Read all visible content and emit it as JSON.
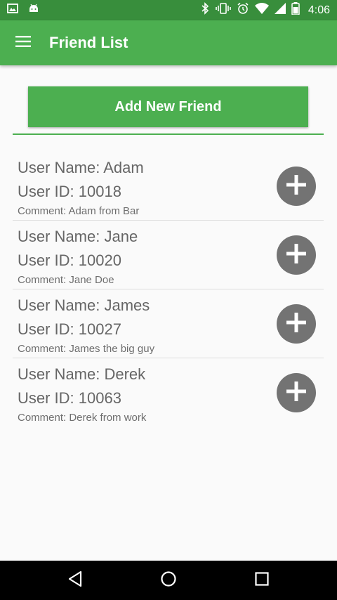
{
  "status_bar": {
    "time": "4:06",
    "left_icons": [
      "image-icon",
      "android-icon"
    ],
    "right_icons": [
      "bluetooth-icon",
      "vibrate-icon",
      "alarm-icon",
      "wifi-icon",
      "signal-icon",
      "battery-icon"
    ]
  },
  "app_bar": {
    "title": "Friend List",
    "menu_icon": "hamburger-menu-icon"
  },
  "actions": {
    "add_friend_label": "Add New Friend"
  },
  "friends": [
    {
      "name": "User Name: Adam",
      "id": "User ID: 10018",
      "comment": "Comment: Adam from Bar"
    },
    {
      "name": "User Name: Jane",
      "id": "User ID: 10020",
      "comment": "Comment: Jane Doe"
    },
    {
      "name": "User Name: James",
      "id": "User ID: 10027",
      "comment": "Comment: James the big guy"
    },
    {
      "name": "User Name: Derek",
      "id": "User ID: 10063",
      "comment": "Comment: Derek from work"
    }
  ],
  "nav_bar": {
    "icons": [
      "back-icon",
      "home-icon",
      "recents-icon"
    ]
  },
  "colors": {
    "status_bar": "#388e3c",
    "primary": "#4caf50",
    "add_circle": "#737373",
    "text": "#666666"
  }
}
